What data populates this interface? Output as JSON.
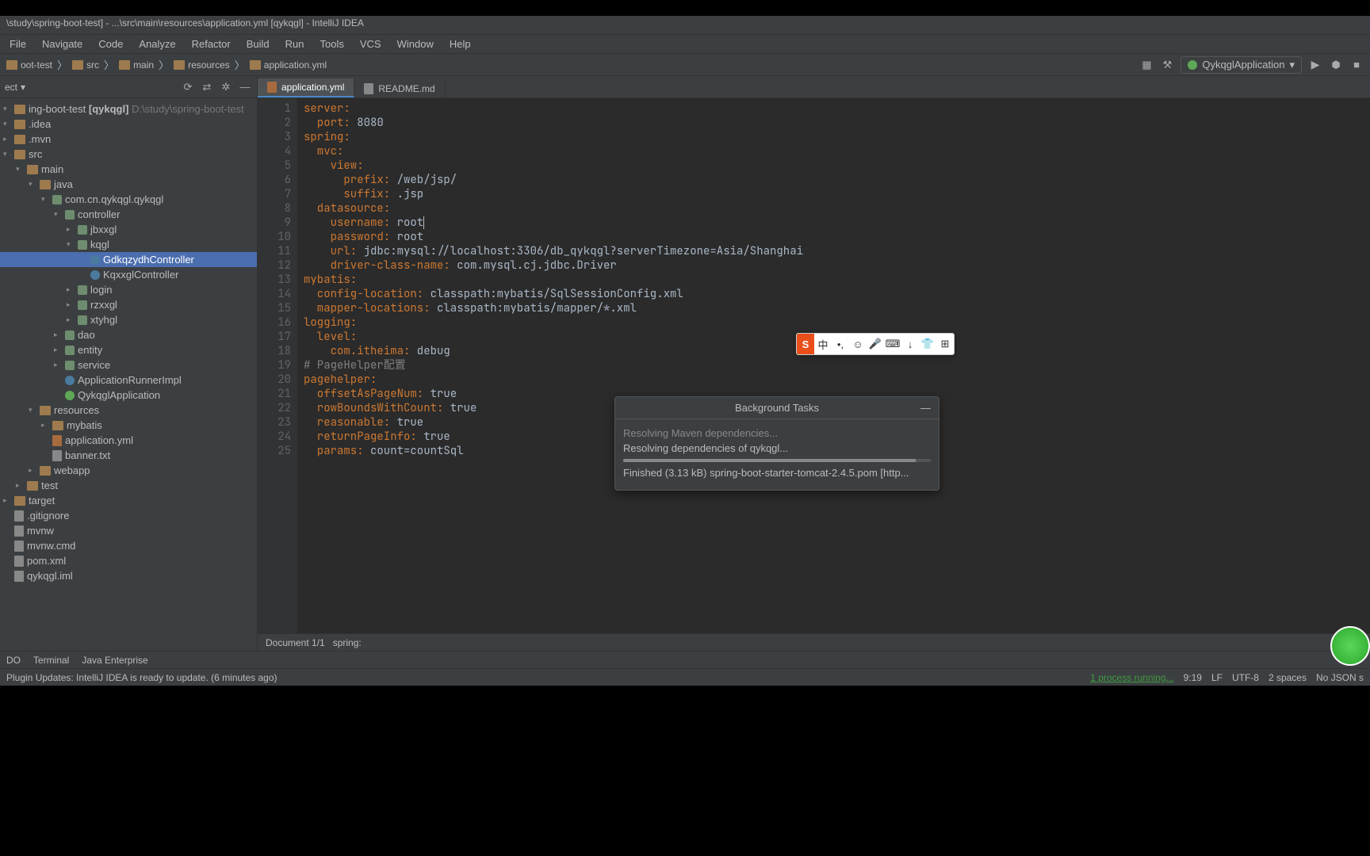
{
  "titlebar": "\\study\\spring-boot-test] - ...\\src\\main\\resources\\application.yml [qykqgl] - IntelliJ IDEA",
  "menu": [
    "File",
    "Navigate",
    "Code",
    "Analyze",
    "Refactor",
    "Build",
    "Run",
    "Tools",
    "VCS",
    "Window",
    "Help"
  ],
  "breadcrumbs": [
    "oot-test",
    "src",
    "main",
    "resources",
    "application.yml"
  ],
  "runConfig": "QykqglApplication",
  "projectPanel": {
    "title": "ect",
    "root": {
      "name": "ing-boot-test",
      "bold": "[qykqgl]",
      "path": "D:\\study\\spring-boot-test"
    }
  },
  "tree": [
    {
      "indent": 0,
      "chev": "▾",
      "icon": "folder",
      "label": ".idea"
    },
    {
      "indent": 0,
      "chev": "▸",
      "icon": "folder",
      "label": ".mvn"
    },
    {
      "indent": 0,
      "chev": "▾",
      "icon": "folder",
      "label": "src"
    },
    {
      "indent": 1,
      "chev": "▾",
      "icon": "folder",
      "label": "main"
    },
    {
      "indent": 2,
      "chev": "▾",
      "icon": "folder",
      "label": "java"
    },
    {
      "indent": 3,
      "chev": "▾",
      "icon": "pkg",
      "label": "com.cn.qykqgl.qykqgl"
    },
    {
      "indent": 4,
      "chev": "▾",
      "icon": "pkg",
      "label": "controller"
    },
    {
      "indent": 5,
      "chev": "▸",
      "icon": "pkg",
      "label": "jbxxgl"
    },
    {
      "indent": 5,
      "chev": "▾",
      "icon": "pkg",
      "label": "kqgl"
    },
    {
      "indent": 6,
      "chev": "",
      "icon": "class",
      "label": "GdkqzydhController",
      "selected": true
    },
    {
      "indent": 6,
      "chev": "",
      "icon": "class",
      "label": "KqxxglController"
    },
    {
      "indent": 5,
      "chev": "▸",
      "icon": "pkg",
      "label": "login"
    },
    {
      "indent": 5,
      "chev": "▸",
      "icon": "pkg",
      "label": "rzxxgl"
    },
    {
      "indent": 5,
      "chev": "▸",
      "icon": "pkg",
      "label": "xtyhgl"
    },
    {
      "indent": 4,
      "chev": "▸",
      "icon": "pkg",
      "label": "dao"
    },
    {
      "indent": 4,
      "chev": "▸",
      "icon": "pkg",
      "label": "entity"
    },
    {
      "indent": 4,
      "chev": "▸",
      "icon": "pkg",
      "label": "service"
    },
    {
      "indent": 4,
      "chev": "",
      "icon": "class",
      "label": "ApplicationRunnerImpl"
    },
    {
      "indent": 4,
      "chev": "",
      "icon": "spring",
      "label": "QykqglApplication"
    },
    {
      "indent": 2,
      "chev": "▾",
      "icon": "folder",
      "label": "resources"
    },
    {
      "indent": 3,
      "chev": "▸",
      "icon": "folder",
      "label": "mybatis"
    },
    {
      "indent": 3,
      "chev": "",
      "icon": "yml",
      "label": "application.yml"
    },
    {
      "indent": 3,
      "chev": "",
      "icon": "file",
      "label": "banner.txt"
    },
    {
      "indent": 2,
      "chev": "▸",
      "icon": "folder",
      "label": "webapp"
    },
    {
      "indent": 1,
      "chev": "▸",
      "icon": "folder",
      "label": "test"
    },
    {
      "indent": 0,
      "chev": "▸",
      "icon": "folder",
      "label": "target"
    },
    {
      "indent": 0,
      "chev": "",
      "icon": "file",
      "label": ".gitignore"
    },
    {
      "indent": 0,
      "chev": "",
      "icon": "file",
      "label": "mvnw"
    },
    {
      "indent": 0,
      "chev": "",
      "icon": "file",
      "label": "mvnw.cmd"
    },
    {
      "indent": 0,
      "chev": "",
      "icon": "file",
      "label": "pom.xml"
    },
    {
      "indent": 0,
      "chev": "",
      "icon": "file",
      "label": "qykqgl.iml"
    }
  ],
  "tabs": [
    {
      "label": "application.yml",
      "active": true,
      "icon": "yml"
    },
    {
      "label": "README.md",
      "active": false,
      "icon": "file"
    }
  ],
  "code": [
    {
      "n": 1,
      "k": "server:",
      "v": ""
    },
    {
      "n": 2,
      "k": "  port:",
      "v": " 8080"
    },
    {
      "n": 3,
      "k": "spring:",
      "v": ""
    },
    {
      "n": 4,
      "k": "  mvc:",
      "v": ""
    },
    {
      "n": 5,
      "k": "    view:",
      "v": ""
    },
    {
      "n": 6,
      "k": "      prefix:",
      "v": " /web/jsp/"
    },
    {
      "n": 7,
      "k": "      suffix:",
      "v": " .jsp"
    },
    {
      "n": 8,
      "k": "  datasource:",
      "v": ""
    },
    {
      "n": 9,
      "k": "    username:",
      "v": " root",
      "caret": true
    },
    {
      "n": 10,
      "k": "    password:",
      "v": " root"
    },
    {
      "n": 11,
      "k": "    url:",
      "v": " jdbc:mysql://localhost:3306/db_qykqgl?serverTimezone=Asia/Shanghai"
    },
    {
      "n": 12,
      "k": "    driver-class-name:",
      "v": " com.mysql.cj.jdbc.Driver"
    },
    {
      "n": 13,
      "k": "mybatis:",
      "v": ""
    },
    {
      "n": 14,
      "k": "  config-location:",
      "v": " classpath:mybatis/SqlSessionConfig.xml"
    },
    {
      "n": 15,
      "k": "  mapper-locations:",
      "v": " classpath:mybatis/mapper/*.xml"
    },
    {
      "n": 16,
      "k": "logging:",
      "v": ""
    },
    {
      "n": 17,
      "k": "  level:",
      "v": ""
    },
    {
      "n": 18,
      "k": "    com.itheima:",
      "v": " debug"
    },
    {
      "n": 19,
      "comment": "# PageHelper配置"
    },
    {
      "n": 20,
      "k": "pagehelper:",
      "v": ""
    },
    {
      "n": 21,
      "k": "  offsetAsPageNum:",
      "v": " true"
    },
    {
      "n": 22,
      "k": "  rowBoundsWithCount:",
      "v": " true"
    },
    {
      "n": 23,
      "k": "  reasonable:",
      "v": " true"
    },
    {
      "n": 24,
      "k": "  returnPageInfo:",
      "v": " true"
    },
    {
      "n": 25,
      "k": "  params:",
      "v": " count=countSql"
    }
  ],
  "breadcrumbBottom": [
    "Document 1/1",
    "spring:"
  ],
  "toolWindows": [
    "DO",
    "Terminal",
    "Java Enterprise"
  ],
  "bgTasks": {
    "title": "Background Tasks",
    "line1": "Resolving Maven dependencies...",
    "line2": "Resolving dependencies of qykqgl...",
    "line3": "Finished (3.13 kB) spring-boot-starter-tomcat-2.4.5.pom [http..."
  },
  "ime": [
    "S",
    "中",
    "•,",
    "☺",
    "🎤",
    "⌨",
    "↓",
    "👕",
    "⊞"
  ],
  "statusbar": {
    "left": "Plugin Updates: IntelliJ IDEA is ready to update. (6 minutes ago)",
    "processes": "1 process running...",
    "pos": "9:19",
    "lf": "LF",
    "enc": "UTF-8",
    "indent": "2 spaces",
    "schema": "No JSON s"
  }
}
